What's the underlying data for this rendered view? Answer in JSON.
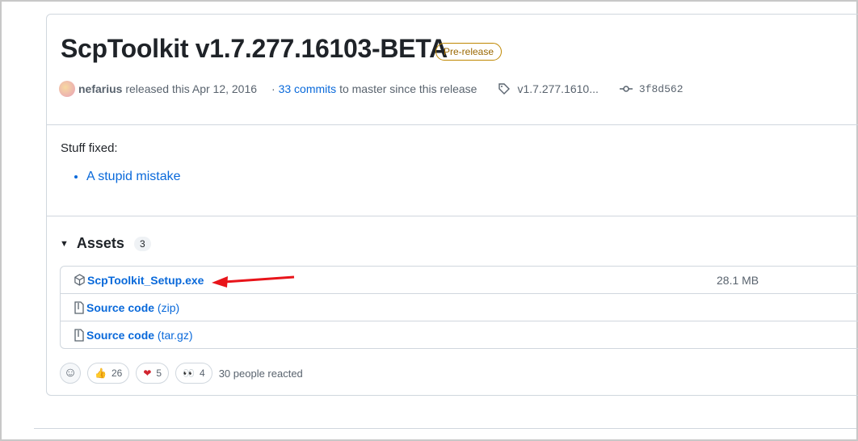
{
  "release": {
    "title": "ScpToolkit v1.7.277.16103-BETA",
    "badge": "Pre-release",
    "author": "nefarius",
    "released_text": "released this Apr 12, 2016",
    "commits_link": "33 commits",
    "commits_rest": "to master since this release",
    "tag": "v1.7.277.1610...",
    "commit": "3f8d562"
  },
  "notes": {
    "heading": "Stuff fixed:",
    "items": [
      "A stupid mistake"
    ]
  },
  "assets": {
    "label": "Assets",
    "count": "3",
    "files": [
      {
        "name": "ScpToolkit_Setup.exe",
        "size": "28.1 MB"
      },
      {
        "name": "Source code",
        "suffix": "(zip)"
      },
      {
        "name": "Source code",
        "suffix": "(tar.gz)"
      }
    ]
  },
  "reactions": {
    "thumbs_up": "26",
    "heart": "5",
    "eyes": "4",
    "summary": "30 people reacted"
  },
  "colors": {
    "link": "#0969da",
    "arrow": "#e8141a",
    "badge": "#9a6700"
  }
}
